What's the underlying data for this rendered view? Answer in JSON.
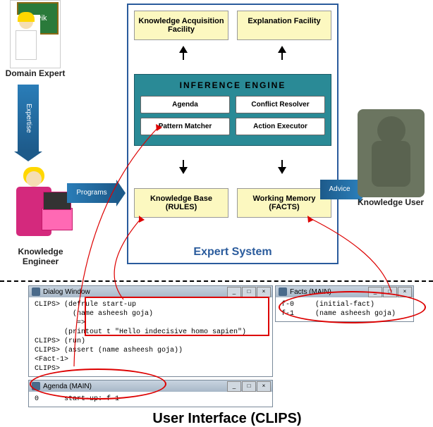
{
  "roles": {
    "domain_expert": "Domain Expert",
    "knowledge_engineer": "Knowledge Engineer",
    "knowledge_user": "Knowledge User"
  },
  "flows": {
    "expertise": "Expertise",
    "programs": "Programs",
    "advice": "Advice"
  },
  "chalkboard": "Σe^ik",
  "expert_system": {
    "title": "Expert System",
    "kaf": "Knowledge Acquisition Facility",
    "ef": "Explanation Facility",
    "inference_engine": {
      "title": "INFERENCE  ENGINE",
      "agenda": "Agenda",
      "conflict_resolver": "Conflict Resolver",
      "pattern_matcher": "Pattern Matcher",
      "action_executor": "Action Executor"
    },
    "kb": "Knowledge Base (RULES)",
    "wm": "Working Memory (FACTS)"
  },
  "clips": {
    "dialog_title": "Dialog Window",
    "facts_title": "Facts (MAIN)",
    "agenda_title": "Agenda (MAIN)",
    "dialog_body": "CLIPS> (defrule start-up\n         (name asheesh goja)\n          =>\n       (printout t \"Hello indecisive homo sapien\")\nCLIPS> (run)\nCLIPS> (assert (name asheesh goja))\n<Fact-1>\nCLIPS>",
    "facts_body": "f-0     (initial-fact)\nf-1     (name asheesh goja)",
    "agenda_body": "0      start-up: f-1"
  },
  "ui_title": "User Interface (CLIPS)"
}
